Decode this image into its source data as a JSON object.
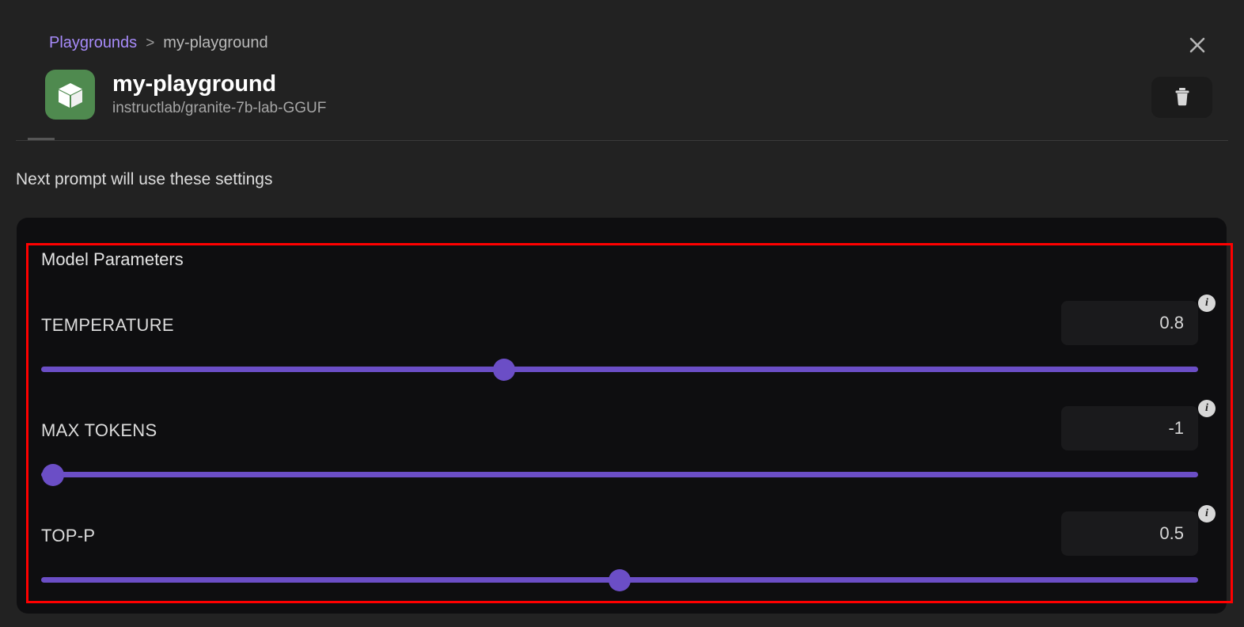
{
  "breadcrumb": {
    "root_label": "Playgrounds",
    "separator": ">",
    "current_label": "my-playground"
  },
  "header": {
    "title": "my-playground",
    "model_name": "instructlab/granite-7b-lab-GGUF",
    "model_icon": "cube-icon",
    "close_icon": "close-icon",
    "delete_icon": "trash-icon"
  },
  "settings_note": "Next prompt will use these settings",
  "card": {
    "heading": "Model Parameters",
    "parameters": [
      {
        "label": "TEMPERATURE",
        "value": "0.8",
        "fill_percent": 40,
        "info_icon": "info-icon"
      },
      {
        "label": "MAX TOKENS",
        "value": "-1",
        "fill_percent": 1,
        "info_icon": "info-icon"
      },
      {
        "label": "TOP-P",
        "value": "0.5",
        "fill_percent": 50,
        "info_icon": "info-icon"
      }
    ]
  },
  "colors": {
    "page_background": "#222222",
    "card_background": "#0e0e10",
    "accent_purple": "#6b4ec6",
    "link_purple": "#a78bfa",
    "highlight_red": "#ff0000",
    "model_icon_green": "#4f8a4f"
  }
}
